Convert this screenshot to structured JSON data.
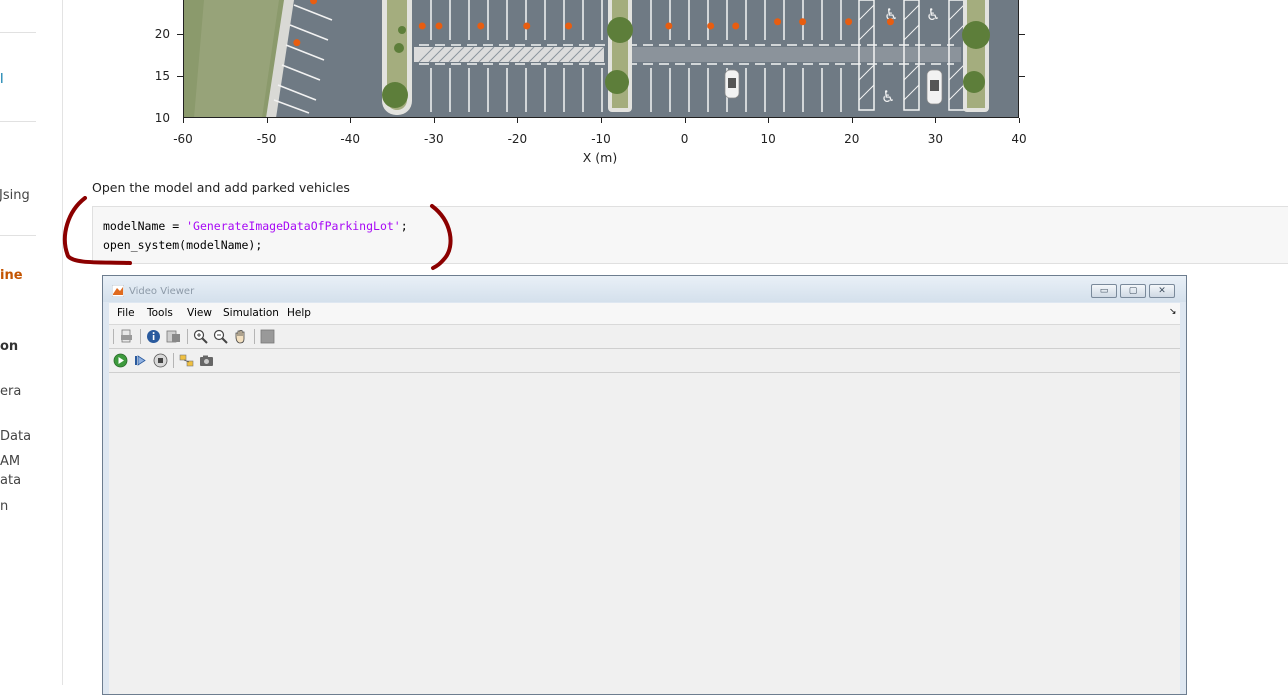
{
  "sidebar": {
    "items": [
      {
        "label": "l"
      },
      {
        "label": "Jsing"
      },
      {
        "label": "ine"
      },
      {
        "label": "on"
      },
      {
        "label": "era"
      },
      {
        "label": "Data"
      },
      {
        "label": "AM"
      },
      {
        "label": "ata"
      },
      {
        "label": "n"
      }
    ]
  },
  "plot": {
    "xlabel": "X (m)",
    "yticks": [
      "20",
      "15",
      "10"
    ],
    "xticks": [
      "-60",
      "-50",
      "-40",
      "-30",
      "-20",
      "-10",
      "0",
      "10",
      "20",
      "30",
      "40"
    ]
  },
  "chart_data": {
    "type": "scatter",
    "xlabel": "X (m)",
    "ylabel": "",
    "xlim": [
      -60,
      40
    ],
    "ylim_visible": [
      10,
      24
    ],
    "background": "parking-lot-image",
    "series": [
      {
        "x": [
          -44.5,
          -46.5,
          -31.5,
          -29.5,
          -24.5,
          -19,
          -14,
          -2,
          3,
          6,
          11,
          14,
          19.5,
          24.5
        ],
        "y": [
          24,
          19,
          21,
          21,
          21,
          21,
          21,
          21,
          21,
          21,
          21.5,
          21.5,
          21.5,
          21.5
        ]
      }
    ]
  },
  "doc": {
    "description": "Open the model and add parked vehicles"
  },
  "code": {
    "line1_prefix": "modelName = ",
    "line1_string": "'GenerateImageDataOfParkingLot'",
    "line1_suffix": ";",
    "line2": "open_system(modelName);"
  },
  "video_viewer": {
    "title": "Video Viewer",
    "menu": [
      "File",
      "Tools",
      "View",
      "Simulation",
      "Help"
    ],
    "toolbar1_icons": [
      "print-icon",
      "info-icon",
      "export-icon",
      "zoom-in-icon",
      "zoom-out-icon",
      "pan-hand-icon",
      "fit-icon"
    ],
    "toolbar2_icons": [
      "run-icon",
      "step-icon",
      "stop-icon",
      "highlight-icon",
      "snapshot-icon"
    ],
    "window_buttons": {
      "minimize": "▭",
      "maximize": "▢",
      "close": "✕"
    },
    "dock_arrow": "↘"
  },
  "colors": {
    "accent": "#c45400",
    "code_string": "#a709f5",
    "annotation": "#8b0000",
    "waypoint": "#e85d10"
  }
}
